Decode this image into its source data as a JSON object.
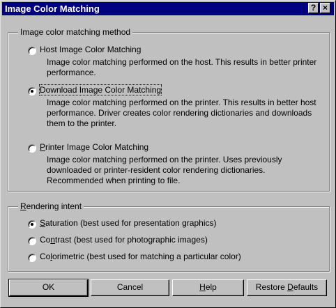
{
  "window": {
    "title": "Image Color Matching",
    "help_button": "?",
    "close_button": "×"
  },
  "method_group": {
    "legend": "Image color matching method",
    "options": [
      {
        "label": "Host Image Color Matching",
        "description": "Image color matching performed on the host. This results in better printer performance.",
        "selected": false
      },
      {
        "label": "Download Image Color Matching",
        "description": "Image color matching performed on the printer. This results in better host performance. Driver creates color rendering dictionaries and downloads them to the printer.",
        "selected": true
      },
      {
        "label_accel": "P",
        "label_rest": "rinter Image Color Matching",
        "description": "Image color matching performed on the printer. Uses previously downloaded or printer-resident color rendering dictionaries. Recommended when printing to file.",
        "selected": false
      }
    ]
  },
  "rendering_group": {
    "legend_accel": "R",
    "legend_rest": "endering intent",
    "options": [
      {
        "label_accel": "S",
        "label_rest": "aturation (best used for presentation graphics)",
        "selected": true
      },
      {
        "label_pre": "Co",
        "label_accel": "n",
        "label_rest": "trast (best used for photographic images)",
        "selected": false
      },
      {
        "label_pre": "Co",
        "label_accel": "l",
        "label_rest": "orimetric (best used for matching a particular color)",
        "selected": false
      }
    ]
  },
  "buttons": {
    "ok": "OK",
    "cancel": "Cancel",
    "help_accel": "H",
    "help_rest": "elp",
    "restore_pre": "Restore ",
    "restore_accel": "D",
    "restore_rest": "efaults"
  }
}
